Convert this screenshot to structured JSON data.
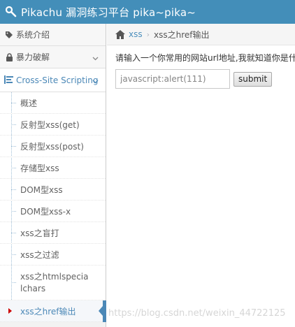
{
  "header": {
    "title": "Pikachu 漏洞练习平台 pika~pika~",
    "icon": "wrench-icon",
    "bg_color": "#438eb9"
  },
  "sidebar": {
    "top_items": [
      {
        "label": "系统介绍",
        "icon": "tag-icon"
      },
      {
        "label": "暴力破解",
        "icon": "lock-icon"
      }
    ],
    "open_section": {
      "label": "Cross-Site Scripting",
      "icon": "list-tree-icon"
    },
    "sub_items": [
      "概述",
      "反射型xss(get)",
      "反射型xss(post)",
      "存储型xss",
      "DOM型xss",
      "DOM型xss-x",
      "xss之盲打",
      "xss之过滤",
      "xss之htmlspecialchars",
      "xss之href输出"
    ],
    "active_index": 9,
    "accent_color": "#4b88b7"
  },
  "breadcrumb": {
    "home_icon": "home-icon",
    "items": [
      "xss",
      "xss之href输出"
    ]
  },
  "main": {
    "prompt": "请输入一个你常用的网站url地址,我就知道你是什么",
    "input_value": "javascript:alert(111)",
    "submit_label": "submit"
  },
  "watermark": "https://blog.csdn.net/weixin_44722125"
}
